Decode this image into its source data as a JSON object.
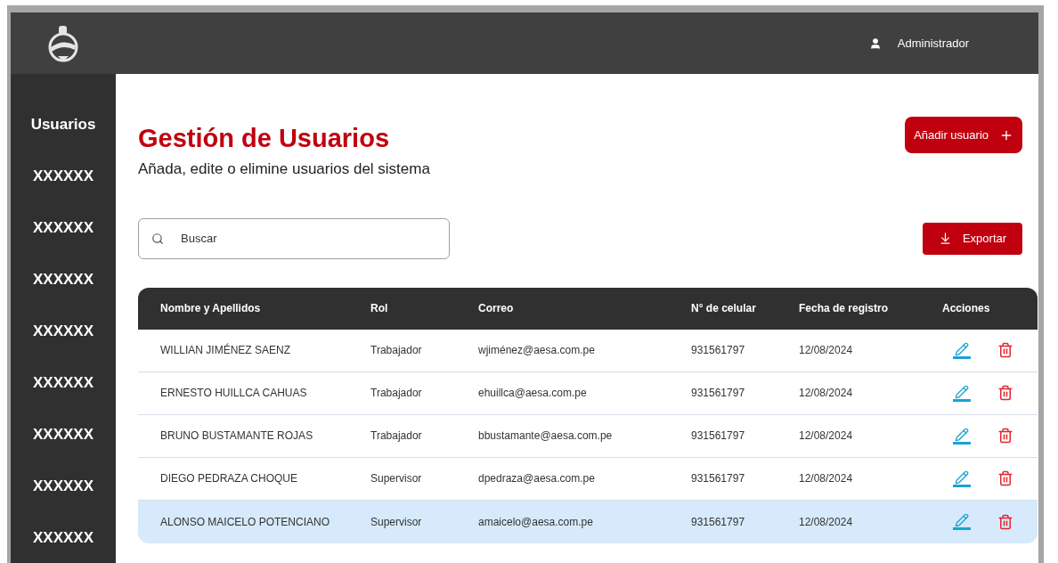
{
  "header": {
    "user": "Administrador"
  },
  "sidebar": {
    "items": [
      "Usuarios",
      "XXXXXX",
      "XXXXXX",
      "XXXXXX",
      "XXXXXX",
      "XXXXXX",
      "XXXXXX",
      "XXXXXX",
      "XXXXXX"
    ]
  },
  "page": {
    "title": "Gestión de Usuarios",
    "subtitle": "Añada, edite o elimine usuarios del sistema",
    "add_button": "Añadir usuario",
    "search": {
      "placeholder": "Buscar"
    },
    "export_button": "Exportar"
  },
  "table": {
    "columns": [
      "Nombre y Apellidos",
      "Rol",
      "Correo",
      "N° de celular",
      "Fecha de registro",
      "Acciones"
    ],
    "rows": [
      {
        "name": "WILLIAN JIMÉNEZ SAENZ",
        "role": "Trabajador",
        "email": "wjiménez@aesa.com.pe",
        "phone": "931561797",
        "date": "12/08/2024",
        "selected": false
      },
      {
        "name": "ERNESTO HUILLCA CAHUAS",
        "role": "Trabajador",
        "email": "ehuillca@aesa.com.pe",
        "phone": "931561797",
        "date": "12/08/2024",
        "selected": false
      },
      {
        "name": "BRUNO BUSTAMANTE ROJAS",
        "role": "Trabajador",
        "email": "bbustamante@aesa.com.pe",
        "phone": "931561797",
        "date": "12/08/2024",
        "selected": false
      },
      {
        "name": "DIEGO PEDRAZA CHOQUE",
        "role": "Supervisor",
        "email": "dpedraza@aesa.com.pe",
        "phone": "931561797",
        "date": "12/08/2024",
        "selected": false
      },
      {
        "name": "ALONSO MAICELO POTENCIANO",
        "role": "Supervisor",
        "email": "amaicelo@aesa.com.pe",
        "phone": "931561797",
        "date": "12/08/2024",
        "selected": true
      }
    ]
  }
}
